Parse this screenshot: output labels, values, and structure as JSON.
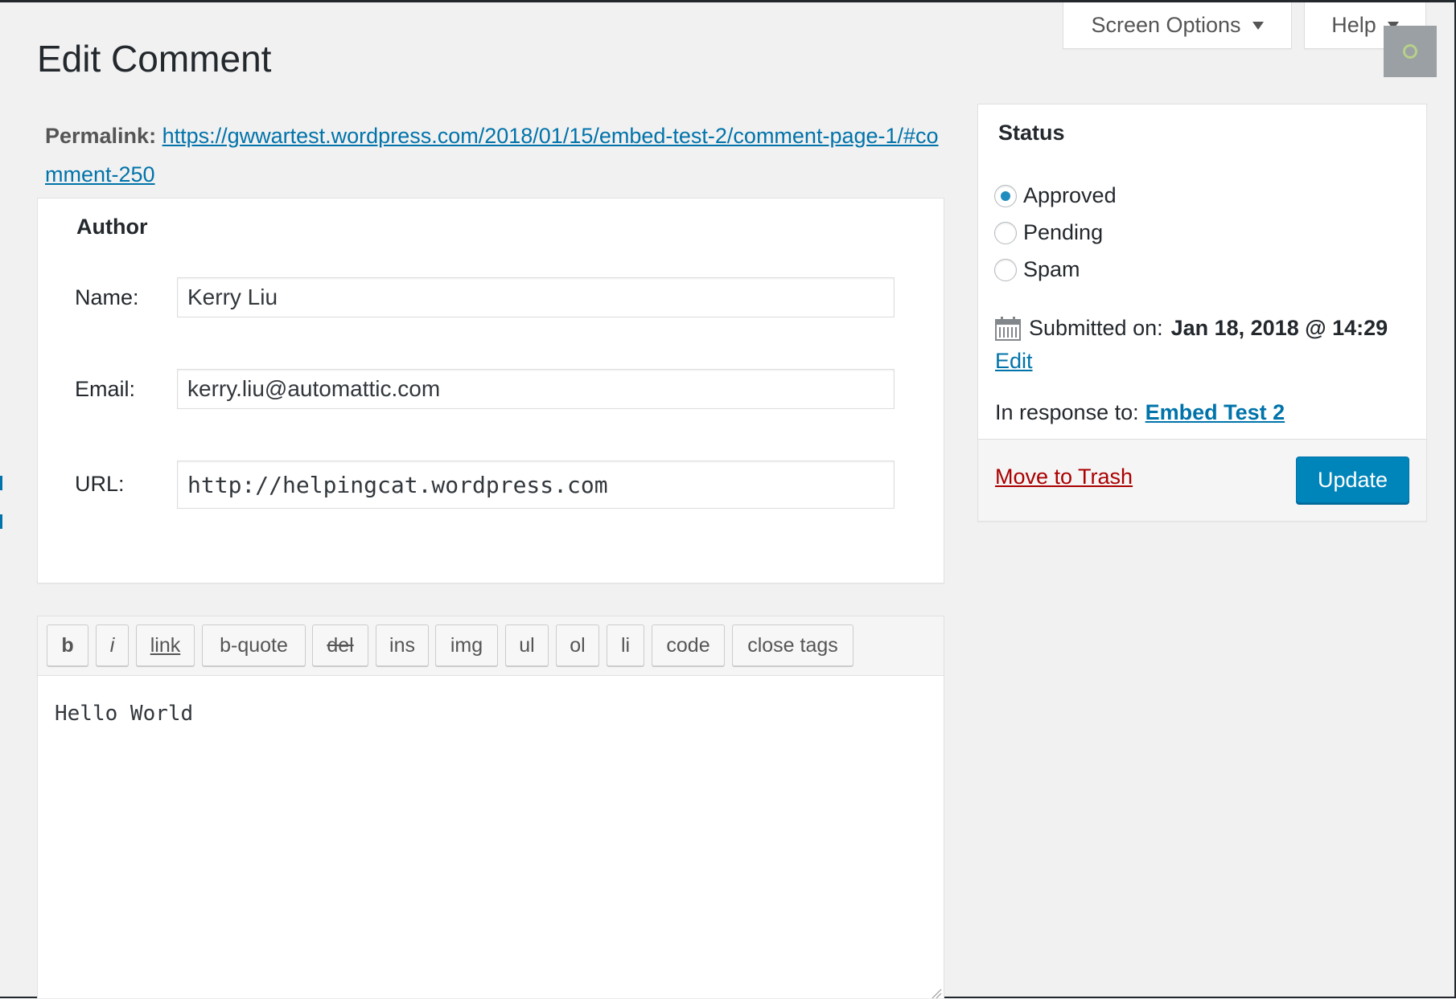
{
  "header": {
    "screen_options_label": "Screen Options",
    "help_label": "Help"
  },
  "page_title": "Edit Comment",
  "permalink": {
    "label": "Permalink:",
    "url": "https://gwwartest.wordpress.com/2018/01/15/embed-test-2/comment-page-1/#comment-250"
  },
  "author": {
    "title": "Author",
    "name_label": "Name:",
    "name_value": "Kerry Liu",
    "email_label": "Email:",
    "email_value": "kerry.liu@automattic.com",
    "url_label": "URL:",
    "url_value": "http://helpingcat.wordpress.com"
  },
  "editor": {
    "buttons": [
      "b",
      "i",
      "link",
      "b-quote",
      "del",
      "ins",
      "img",
      "ul",
      "ol",
      "li",
      "code",
      "close tags"
    ],
    "content": "Hello World"
  },
  "status": {
    "title": "Status",
    "options": [
      {
        "label": "Approved",
        "checked": true
      },
      {
        "label": "Pending",
        "checked": false
      },
      {
        "label": "Spam",
        "checked": false
      }
    ],
    "submitted_label": "Submitted on:",
    "submitted_value": "Jan 18, 2018 @ 14:29",
    "edit_link": "Edit",
    "response_label": "In response to:",
    "response_link": "Embed Test 2",
    "trash_link": "Move to Trash",
    "update_button": "Update"
  },
  "icons": [
    "calendar-icon",
    "chevron-down-icon",
    "radio-icon",
    "resize-handle-icon"
  ],
  "colors": {
    "accent": "#0073aa",
    "button_primary": "#0085ba",
    "trash": "#aa0000",
    "background": "#f1f1f1"
  }
}
